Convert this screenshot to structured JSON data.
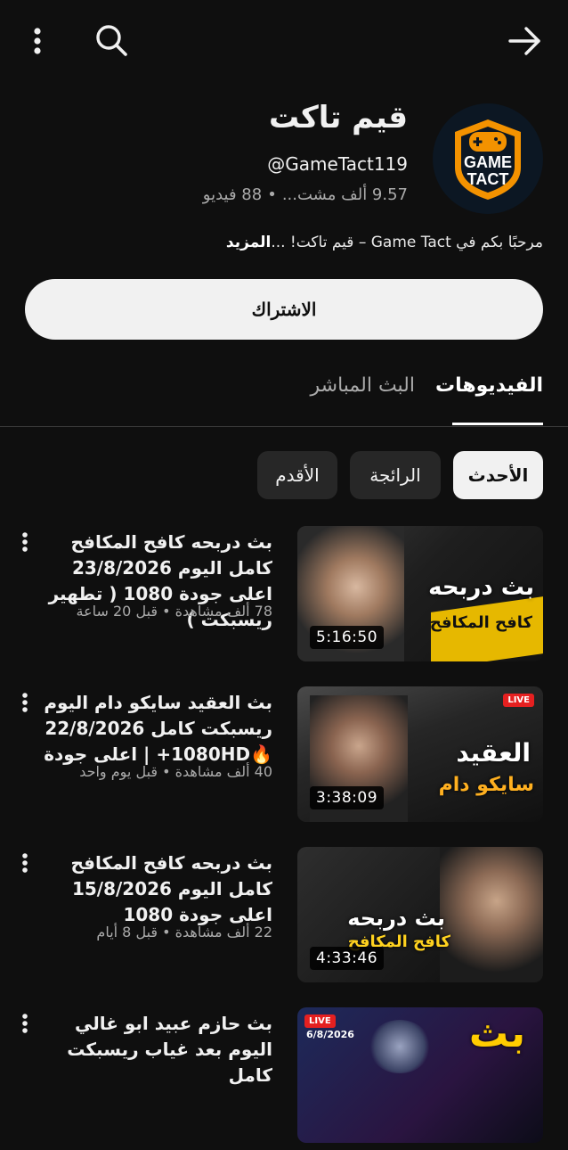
{
  "topbar": {
    "menu_icon": "more-vert-icon",
    "search_icon": "search-icon",
    "forward_icon": "arrow-forward-icon"
  },
  "channel": {
    "name": "قيم تاكت",
    "handle": "@GameTact119",
    "subscribers": "9.57 ألف مشت...",
    "separator": "•",
    "videos": "88 فيديو",
    "description": "مرحبًا بكم في Game Tact – قيم تاكت! ...",
    "more_label": "المزيد",
    "logo_line1": "GAME",
    "logo_line2": "TACT",
    "logo_colors": {
      "orange": "#f39200",
      "dark": "#0c1723"
    }
  },
  "subscribe_label": "الاشتراك",
  "tabs": [
    {
      "label": "الفيديوهات",
      "selected": true
    },
    {
      "label": "البث المباشر",
      "selected": false
    }
  ],
  "filters": [
    {
      "label": "الأحدث",
      "selected": true
    },
    {
      "label": "الرائجة",
      "selected": false
    },
    {
      "label": "الأقدم",
      "selected": false
    }
  ],
  "videos": [
    {
      "title": "بث دربحه كافح المكافح كامل اليوم 23/8/2026 اعلى جودة 1080 ( تطهير ريسبكت )",
      "meta": "78 ألف مشاهدة • قبل 20 ساعة",
      "duration": "5:16:50",
      "thumb_text": "بث دربحه",
      "thumb_text2": "كافح المكافح"
    },
    {
      "title": "بث العقيد سايكو دام اليوم ريسبكت كامل 22/8/2026 🔥1080HD+ | اعلى جودة",
      "meta": "40 ألف مشاهدة • قبل يوم واحد",
      "duration": "3:38:09",
      "thumb_text": "العقيد",
      "thumb_text2": "سايكو دام",
      "thumb_badge": "LIVE"
    },
    {
      "title": "بث دربحه كافح المكافح كامل اليوم 15/8/2026 اعلى جودة 1080",
      "meta": "22 ألف مشاهدة • قبل 8 أيام",
      "duration": "4:33:46",
      "thumb_text": "بث دربحه",
      "thumb_text2": "كافح المكافح"
    },
    {
      "title": "بث حازم عبيد ابو غالي اليوم بعد غياب ريسبكت كامل",
      "meta": "",
      "duration": "",
      "thumb_text": "بث",
      "thumb_badge": "LIVE",
      "thumb_date": "6/8/2026"
    }
  ]
}
